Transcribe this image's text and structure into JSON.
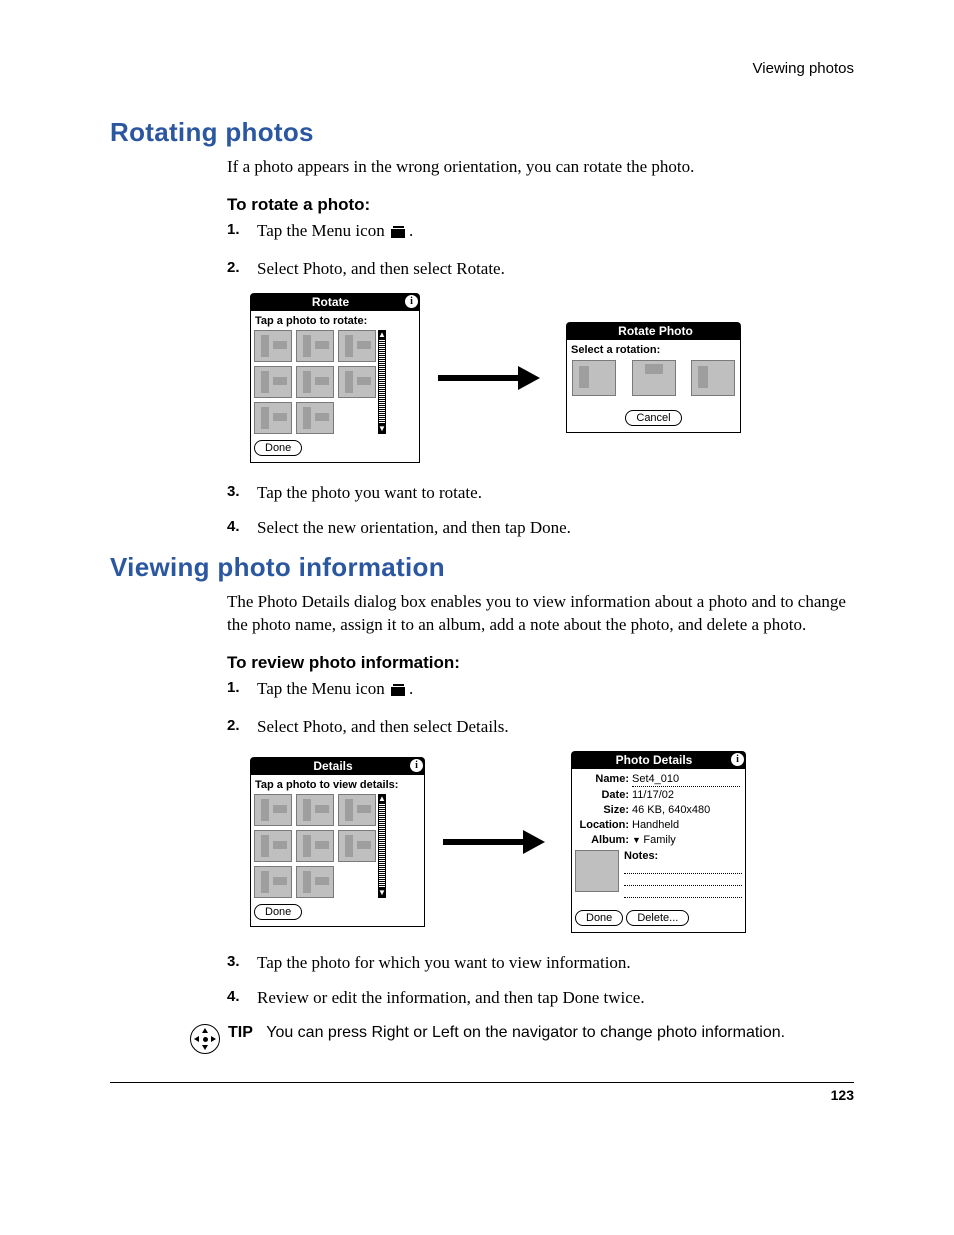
{
  "running_head": "Viewing photos",
  "page_number": "123",
  "sections": {
    "rotating": {
      "title": "Rotating photos",
      "intro": "If a photo appears in the wrong orientation, you can rotate the photo.",
      "subhead": "To rotate a photo:",
      "step1_pre": "Tap the Menu icon ",
      "step1_post": ".",
      "step2": "Select Photo, and then select Rotate.",
      "step3": "Tap the photo you want to rotate.",
      "step4": "Select the new orientation, and then tap Done.",
      "nums": {
        "n1": "1.",
        "n2": "2.",
        "n3": "3.",
        "n4": "4."
      }
    },
    "viewing": {
      "title": "Viewing photo information",
      "intro": "The Photo Details dialog box enables you to view information about a photo and to change the photo name, assign it to an album, add a note about the photo, and delete a photo.",
      "subhead": "To review photo information:",
      "step1_pre": "Tap the Menu icon ",
      "step1_post": ".",
      "step2": "Select Photo, and then select Details.",
      "step3": "Tap the photo for which you want to view information.",
      "step4": "Review or edit the information, and then tap Done twice.",
      "nums": {
        "n1": "1.",
        "n2": "2.",
        "n3": "3.",
        "n4": "4."
      }
    }
  },
  "dialogs": {
    "rotate": {
      "title": "Rotate",
      "sub": "Tap a photo to rotate:",
      "done": "Done"
    },
    "rotate_photo": {
      "title": "Rotate Photo",
      "sub": "Select a rotation:",
      "cancel": "Cancel"
    },
    "details": {
      "title": "Details",
      "sub": "Tap a photo to view details:",
      "done": "Done"
    },
    "photo_details": {
      "title": "Photo Details",
      "labels": {
        "name": "Name:",
        "date": "Date:",
        "size": "Size:",
        "location": "Location:",
        "album": "Album:",
        "notes": "Notes:"
      },
      "values": {
        "name": "Set4_010",
        "date": "11/17/02",
        "size": "46 KB, 640x480",
        "location": "Handheld",
        "album": "Family"
      },
      "done": "Done",
      "delete": "Delete..."
    }
  },
  "tip": {
    "label": "TIP",
    "text": "You can press Right or Left on the navigator to change photo information."
  },
  "info_glyph": "i"
}
